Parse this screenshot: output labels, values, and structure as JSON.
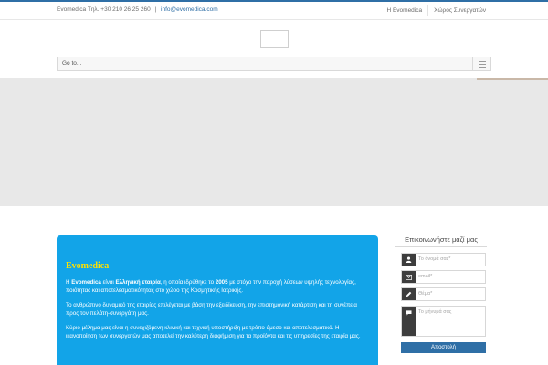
{
  "topbar": {
    "contact_prefix": "Evomedica Tηλ. +30 210 26 25 260",
    "separator": "|",
    "email": "info@evomedica.com",
    "nav": [
      "Η Evomedica",
      "Χώρος Συνεργατών"
    ]
  },
  "menu": {
    "goto_label": "Go to..."
  },
  "info": {
    "title": "Evomedica",
    "p1_a": "Η ",
    "p1_brand": "Evomedica",
    "p1_b": " είναι ",
    "p1_bold": "Ελληνική εταιρία",
    "p1_c": ", η οποία ιδρύθηκε το ",
    "p1_year": "2005",
    "p1_d": " με στόχο την παροχή λύσεων υψηλής τεχνολογίας, ποιότητας και αποτελεσματικότητας στο χώρο της Κοσμητικής Ιατρικής.",
    "p2": "Το ανθρώπινο δυναμικό της εταιρίας επιλέγεται με βάση την εξειδίκευση, την επιστημονική κατάρτιση και τη συνέπεια προς τον πελάτη-συνεργάτη μας.",
    "p3": "Κύριο μέλημα μας είναι η συνεχιζόμενη κλινική και τεχνική υποστήριξη με τρόπο άμεσο και αποτελεσματικό. Η ικανοποίηση των συνεργατών μας αποτελεί την καλύτερη διαφήμιση για τα προϊόντα και τις υπηρεσίες της εταιρία μας."
  },
  "form": {
    "title": "Επικοινωνήστε μαζί μας",
    "name_placeholder": "Το όνομά σας*",
    "email_placeholder": "email*",
    "subject_placeholder": "Θέμα*",
    "message_placeholder": "Το μήνυμά σας",
    "submit_label": "Αποστολή",
    "icons": [
      "user-icon",
      "email-icon",
      "edit-icon",
      "comment-icon"
    ]
  },
  "colors": {
    "accent": "#2f6fa6",
    "info_bg": "#12a4e8",
    "info_title": "#ffe100",
    "icon_bg": "#3d3d3d"
  }
}
